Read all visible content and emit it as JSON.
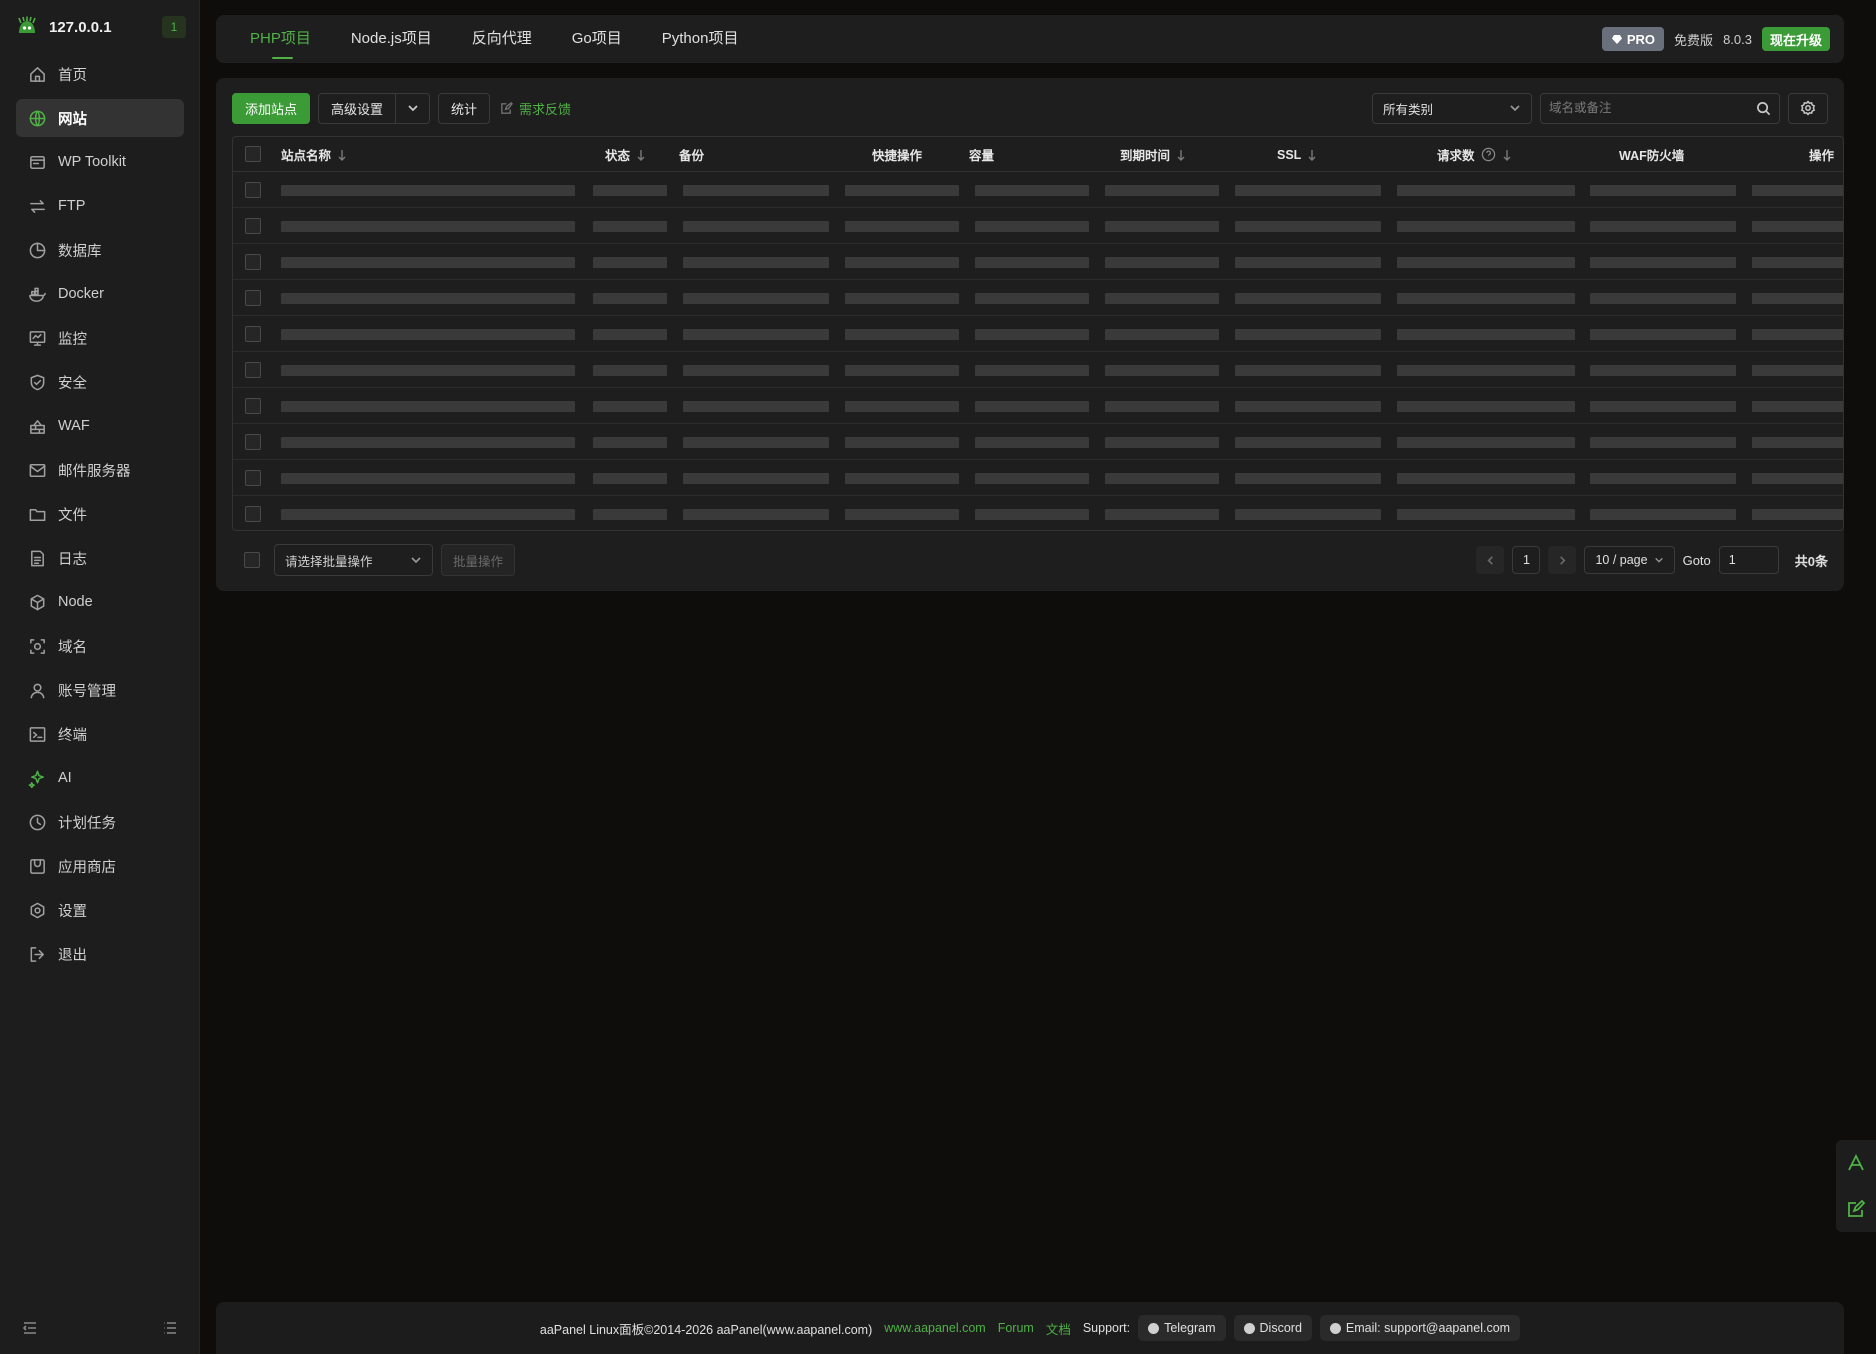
{
  "sidebar": {
    "host": "127.0.0.1",
    "badge": "1",
    "items": [
      {
        "label": "首页",
        "icon": "home-icon"
      },
      {
        "label": "网站",
        "icon": "globe-icon",
        "active": true
      },
      {
        "label": "WP Toolkit",
        "icon": "wordpress-icon"
      },
      {
        "label": "FTP",
        "icon": "transfer-icon"
      },
      {
        "label": "数据库",
        "icon": "database-icon"
      },
      {
        "label": "Docker",
        "icon": "docker-icon"
      },
      {
        "label": "监控",
        "icon": "monitor-icon"
      },
      {
        "label": "安全",
        "icon": "shield-icon"
      },
      {
        "label": "WAF",
        "icon": "firewall-icon"
      },
      {
        "label": "邮件服务器",
        "icon": "mail-icon"
      },
      {
        "label": "文件",
        "icon": "folder-icon"
      },
      {
        "label": "日志",
        "icon": "log-icon"
      },
      {
        "label": "Node",
        "icon": "node-icon"
      },
      {
        "label": "域名",
        "icon": "domain-icon"
      },
      {
        "label": "账号管理",
        "icon": "user-icon"
      },
      {
        "label": "终端",
        "icon": "terminal-icon"
      },
      {
        "label": "AI",
        "icon": "ai-sparkle-icon"
      },
      {
        "label": "计划任务",
        "icon": "clock-icon"
      },
      {
        "label": "应用商店",
        "icon": "store-icon"
      },
      {
        "label": "设置",
        "icon": "settings-icon"
      },
      {
        "label": "退出",
        "icon": "logout-icon"
      }
    ]
  },
  "topbar": {
    "tabs": [
      "PHP项目",
      "Node.js项目",
      "反向代理",
      "Go项目",
      "Python项目"
    ],
    "active_tab": 0,
    "pro_label": "PRO",
    "edition": "免费版",
    "version": "8.0.3",
    "upgrade_label": "现在升级"
  },
  "toolbar": {
    "add_site": "添加站点",
    "advanced": "高级设置",
    "stats": "统计",
    "feedback": "需求反馈",
    "category_select": "所有类别",
    "search_placeholder": "域名或备注"
  },
  "table": {
    "columns": [
      "站点名称",
      "状态",
      "备份",
      "快捷操作",
      "容量",
      "到期时间",
      "SSL",
      "请求数",
      "WAF防火墙",
      "操作"
    ],
    "loading_rows": 10
  },
  "footer_bar": {
    "batch_placeholder": "请选择批量操作",
    "batch_button": "批量操作",
    "page": "1",
    "page_size": "10 / page",
    "goto_label": "Goto",
    "goto_value": "1",
    "total": "共0条"
  },
  "page_footer": {
    "copyright": "aaPanel Linux面板©2014-2026 aaPanel(www.aapanel.com)",
    "site_link": "www.aapanel.com",
    "forum": "Forum",
    "docs": "文档",
    "support_label": "Support:",
    "telegram": "Telegram",
    "discord": "Discord",
    "email": "Email: support@aapanel.com"
  },
  "colors": {
    "accent": "#4fb146",
    "primary_button": "#3b9b37",
    "background": "#0e0d0b",
    "panel": "#1e1e1e"
  }
}
